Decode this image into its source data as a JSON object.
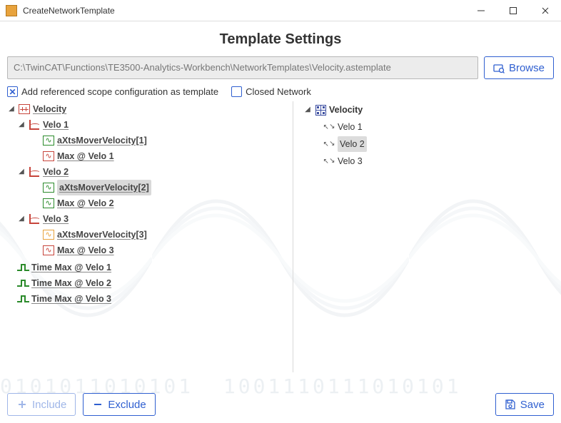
{
  "window": {
    "title": "CreateNetworkTemplate"
  },
  "header": "Template Settings",
  "path": {
    "value": "C:\\TwinCAT\\Functions\\TE3500-Analytics-Workbench\\NetworkTemplates\\Velocity.astemplate"
  },
  "buttons": {
    "browse": "Browse",
    "include": "Include",
    "exclude": "Exclude",
    "save": "Save"
  },
  "checks": {
    "addRef": {
      "label": "Add referenced scope configuration as template",
      "checked": true
    },
    "closed": {
      "label": "Closed Network",
      "checked": false
    }
  },
  "leftTree": {
    "root": "Velocity",
    "groups": [
      {
        "name": "Velo 1",
        "items": [
          {
            "label": "aXtsMoverVelocity[1]",
            "style": "green",
            "selected": false
          },
          {
            "label": "Max @ Velo 1",
            "style": "red",
            "selected": false
          }
        ]
      },
      {
        "name": "Velo 2",
        "items": [
          {
            "label": "aXtsMoverVelocity[2]",
            "style": "green",
            "selected": true
          },
          {
            "label": "Max @ Velo 2",
            "style": "green",
            "selected": false
          }
        ]
      },
      {
        "name": "Velo 3",
        "items": [
          {
            "label": "aXtsMoverVelocity[3]",
            "style": "orange",
            "selected": false
          },
          {
            "label": "Max @ Velo 3",
            "style": "red",
            "selected": false
          }
        ]
      }
    ],
    "extras": [
      "Time Max @ Velo 1",
      "Time Max @ Velo 2",
      "Time Max @ Velo 3"
    ]
  },
  "rightTree": {
    "root": "Velocity",
    "items": [
      {
        "label": "Velo 1",
        "selected": false
      },
      {
        "label": "Velo 2",
        "selected": true
      },
      {
        "label": "Velo 3",
        "selected": false
      }
    ]
  }
}
